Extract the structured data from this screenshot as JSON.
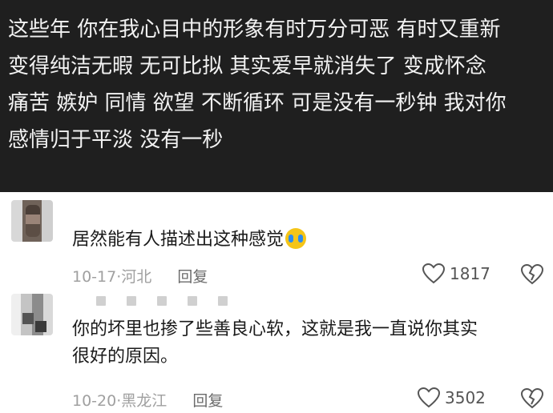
{
  "post": {
    "text": "这些年 你在我心目中的形象有时万分可恶 有时又重新\n变得纯洁无暇 无可比拟 其实爱早就消失了 变成怀念\n痛苦 嫉妒 同情 欲望 不断循环 可是没有一秒钟 我对你\n感情归于平淡 没有一秒"
  },
  "comments": [
    {
      "text": "居然能有人描述出这种感觉",
      "emoji": "crying-face-emoji",
      "date": "10-17",
      "location": "河北",
      "reply_label": "回复",
      "likes": "1817"
    },
    {
      "text": "你的坏里也掺了些善良心软，这就是我一直说你其实\n很好的原因。",
      "date": "10-20",
      "location": "黑龙江",
      "reply_label": "回复",
      "likes": "3502"
    }
  ],
  "colors": {
    "post_background": "#1f1f1f",
    "post_text": "#f2f2f2",
    "meta_text": "#a0a0a0",
    "icon": "#555555"
  }
}
